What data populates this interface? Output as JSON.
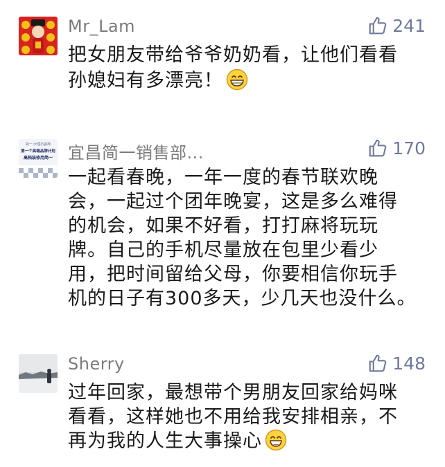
{
  "comments": [
    {
      "username": "Mr_Lam",
      "likes": "241",
      "avatar_icon": "god-of-wealth-avatar",
      "lines": [
        "把女朋友带给爷爷奶奶看，让他们看看",
        "孙媳妇有多漂亮！"
      ],
      "emoji": "grinning-face-icon"
    },
    {
      "username": "宜昌简一销售部...",
      "likes": "170",
      "avatar_icon": "brand-ad-avatar",
      "avatar_text": [
        "简一·大理石瓷砖",
        "第一个高端品牌计划",
        "高档装修用简一"
      ],
      "lines": [
        "一起看春晚，一年一度的春节联欢晚",
        "会，一起过个团年晚宴，这是多么难得",
        "的机会，如果不好看，打打麻将玩玩",
        "牌。自己的手机尽量放在包里少看少",
        "用，把时间留给父母，你要相信你玩手",
        "机的日子有300多天，少几天也没什么。"
      ]
    },
    {
      "username": "Sherry",
      "likes": "148",
      "avatar_icon": "snowy-landscape-avatar",
      "lines": [
        "过年回家，最想带个男朋友回家给妈咪",
        "看看，这样她也不用给我安排相亲，不",
        "再为我的人生大事操心"
      ],
      "emoji": "smiling-face-icon"
    }
  ],
  "colors": {
    "like": "#6f7a9c",
    "username": "#7b7b7b",
    "text": "#1a1a1a"
  }
}
